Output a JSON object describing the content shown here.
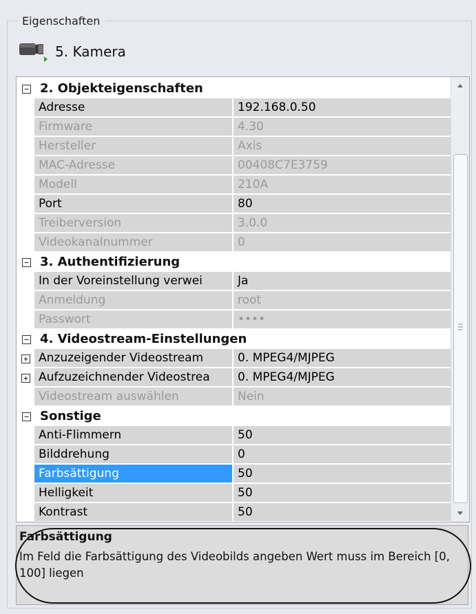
{
  "panel": {
    "title": "Eigenschaften"
  },
  "camera": {
    "title": "5. Kamera",
    "icon": "camera-icon",
    "status_color": "#2a9d2a"
  },
  "grid": {
    "categories": [
      {
        "title": "2. Objekteigenschaften",
        "rows": [
          {
            "name": "Adresse",
            "value": "192.168.0.50",
            "readonly": false
          },
          {
            "name": "Firmware",
            "value": "4.30",
            "readonly": true
          },
          {
            "name": "Hersteller",
            "value": "Axis",
            "readonly": true
          },
          {
            "name": "MAC-Adresse",
            "value": "00408C7E3759",
            "readonly": true
          },
          {
            "name": "Modell",
            "value": "210A",
            "readonly": true
          },
          {
            "name": "Port",
            "value": "80",
            "readonly": false
          },
          {
            "name": "Treiberversion",
            "value": "3.0.0",
            "readonly": true
          },
          {
            "name": "Videokanalnummer",
            "value": "0",
            "readonly": true
          }
        ]
      },
      {
        "title": "3. Authentifizierung",
        "rows": [
          {
            "name": "In der Voreinstellung verwei",
            "value": "Ja",
            "readonly": false
          },
          {
            "name": "Anmeldung",
            "value": "root",
            "readonly": true
          },
          {
            "name": "Passwort",
            "value": "••••",
            "readonly": true
          }
        ]
      },
      {
        "title": "4. Videostream-Einstellungen",
        "rows": [
          {
            "name": "Anzuzeigender Videostream",
            "value": "0. MPEG4/MJPEG",
            "readonly": false,
            "expandable": true
          },
          {
            "name": "Aufzuzeichnender Videostrea",
            "value": "0. MPEG4/MJPEG",
            "readonly": false,
            "expandable": true
          },
          {
            "name": "Videostream auswählen",
            "value": "Nein",
            "readonly": true
          }
        ]
      },
      {
        "title": "Sonstige",
        "rows": [
          {
            "name": "Anti-Flimmern",
            "value": "50",
            "readonly": false
          },
          {
            "name": "Bilddrehung",
            "value": "0",
            "readonly": false
          },
          {
            "name": "Farbsättigung",
            "value": "50",
            "readonly": false,
            "selected": true
          },
          {
            "name": "Helligkeit",
            "value": "50",
            "readonly": false
          },
          {
            "name": "Kontrast",
            "value": "50",
            "readonly": false
          }
        ]
      }
    ],
    "collapse_symbol": "−",
    "expand_symbol": "+",
    "selection_color": "#3399ff"
  },
  "help": {
    "title": "Farbsättigung",
    "text": "Im Feld die Farbsättigung des Videobilds angeben Wert muss im Bereich [0, 100] liegen"
  }
}
